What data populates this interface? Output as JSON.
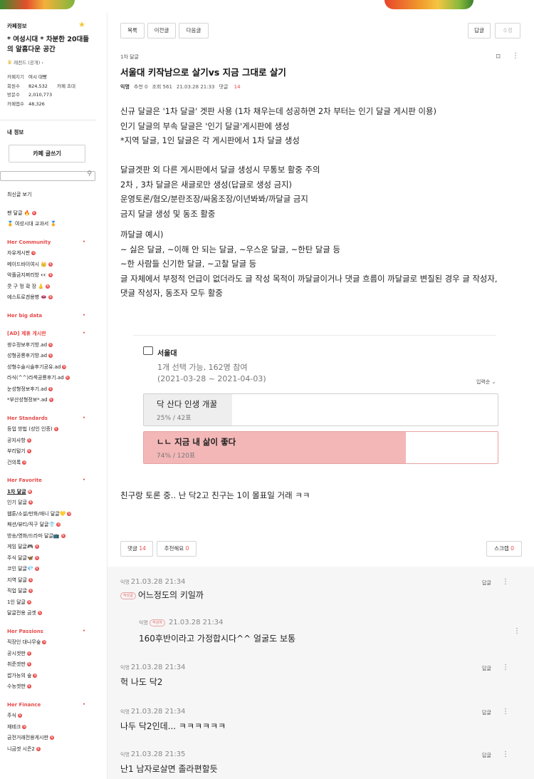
{
  "sidebar": {
    "header": "카페정보",
    "cafe_name": "* 여성시대 * 차분한 20대들의 알흠다운 공간",
    "level": "레전드 (공개)",
    "stats": [
      {
        "k": "카페지기",
        "v": "여시 대빵",
        "k2": "",
        "v2": ""
      },
      {
        "k": "회원수",
        "v": "824,532",
        "k2": "카페 초대",
        "v2": ""
      },
      {
        "k": "방문수",
        "v": "2,010,773",
        "k2": "",
        "v2": ""
      },
      {
        "k": "카페앱수",
        "v": "48,326",
        "k2": "",
        "v2": ""
      }
    ],
    "my_info": "내 정보",
    "write_button": "카페 글쓰기",
    "search_placeholder": "",
    "latest": "최신글 보기",
    "pinned": [
      "팬 달글 🔥",
      "🏅 여성시대 교과서 🏅"
    ],
    "groups": [
      {
        "title": "Her Community",
        "items": [
          "자유게시판",
          "메이드바이여시 👑",
          "악플금지쩌리방 👀",
          "콧 구 멍 확 장  👃",
          "에스트로겐용병 👄"
        ]
      },
      {
        "title": "Her big data",
        "items": []
      },
      {
        "title": "[AD] 제휴 게시판",
        "items": [
          "쌍수정보후기방.ad",
          "성형공룡후기방.ad",
          "성형수술시술후기공유.ad",
          "라식(^^)라섹공룡후기.ad",
          "눈성형정보후기.ad",
          "*부산성형정보*.ad"
        ]
      },
      {
        "title": "Her Standards",
        "items": [
          "등업 방법 (성인 인증)",
          "공지사항",
          "부리털기",
          "건의록"
        ]
      },
      {
        "title": "Her Favorite",
        "items": [
          "1차 달글",
          "인기 달글",
          "웹툰/소설/만화/애니 달글💛",
          "패션/뷰티/직구 달글👕",
          "방송/영화/드라마 달글📺",
          "게임 달글🎮",
          "주식 달글🦋",
          "코인 달글💎",
          "지역 달글",
          "직업 달글",
          "1인 달글",
          "달글전용 금겟"
        ]
      },
      {
        "title": "Her Passions",
        "items": [
          "직장인 대나무숲",
          "공시겟판",
          "취준겟판",
          "쌉가능의 숲",
          "수능겟판"
        ]
      },
      {
        "title": "Her Finance",
        "items": [
          "주식",
          "재테크",
          "금전거래전용게시판",
          "니금겟 시즌2"
        ]
      }
    ]
  },
  "toolbar": {
    "list": "목록",
    "prev": "이전글",
    "next": "다음글",
    "reply": "답글",
    "edit": "수정"
  },
  "article": {
    "board": "1차 달글",
    "title": "서울대 키작남으로 살기vs 지금 그대로 살기",
    "author": "익명",
    "recommend": "추천 0",
    "views": "조회 561",
    "date": "21.03.28 21:33",
    "comments_label": "댓글",
    "comments_count": "14",
    "body": [
      "신규 달글은 '1차 달글' 겟판 사용 (1차 채우는데 성공하면 2차 부터는 인기 달글 게시판 이용)",
      "인기 달글의 부속 달글은 '인기 달글'게시판에 생성",
      "*지역 달글, 1인 달글은 각 게시판에서 1차 달글 생성",
      "",
      "달글겟판 외 다른 게시판에서 달글 생성시 무통보 활중 주의",
      "2차 , 3차 달글은 새글로만 생성(답글로 생성 금지)",
      "운영토론/혐오/분란조장/싸움조장/이년봐봐/까달글 금지",
      "금지 달글 생성 및 동조 활중",
      "-",
      "까달글 예시)",
      "~ 싫은 달글, ~이해 안 되는 달글, ~우스운 달글, ~한탄 달글 등",
      "~한 사람들 신기한 달글, ~고찰 달글 등",
      "글 자체에서 부정적 언급이 없더라도 글 작성 목적이 까달글이거나 댓글 흐름이 까달글로 변질된 경우 글 작성자,",
      "댓글 작성자, 동조자 모두 활중"
    ],
    "after_poll": "친구랑 토론 중.. 난 닥2고 친구는 1이 몰표일 거래 ㅋㅋ"
  },
  "poll": {
    "title": "서울대",
    "subtitle": "1개 선택 가능, 162명 참여",
    "period": "(2021-03-28 ~ 2021-04-03)",
    "sort": "입력순",
    "options": [
      {
        "label": "닥 산다 인생 개꿀",
        "result": "25% / 42표",
        "percent": 25,
        "color": "#eeeeee"
      },
      {
        "label": "ㄴㄴ 지금 내 삶이 좋다",
        "result": "74% / 120표",
        "percent": 74,
        "color": "#f3b7b7"
      }
    ]
  },
  "actions": {
    "comments": "댓글",
    "comments_count": "14",
    "recommend": "추천해요",
    "recommend_count": "0",
    "scrap": "스크랩",
    "scrap_count": "0"
  },
  "comments": [
    {
      "author": "익명",
      "time": "21.03.28 21:34",
      "tag": "작성글",
      "text": "어느정도의 키일까",
      "reply": "답글"
    },
    {
      "author": "익명",
      "time": "21.03.28 21:34",
      "tag": "작성자",
      "text": "160후반이라고 가정합시다^^ 얼굴도 보통",
      "reply": ""
    },
    {
      "author": "익명",
      "time": "21.03.28 21:34",
      "tag": "",
      "text": "헉 나도 닥2",
      "reply": "답글"
    },
    {
      "author": "익명",
      "time": "21.03.28 21:34",
      "tag": "",
      "text": "나두 닥2인데... ㅋㅋㅋㅋㅋㅋ",
      "reply": "답글"
    },
    {
      "author": "익명",
      "time": "21.03.28 21:35",
      "tag": "",
      "text": "난1 남자로살면 졸라편할듯",
      "reply": "답글"
    }
  ],
  "colors": {
    "accent": "#e84a4a",
    "poll_selected": "#f3b7b7",
    "poll_other": "#eeeeee"
  }
}
